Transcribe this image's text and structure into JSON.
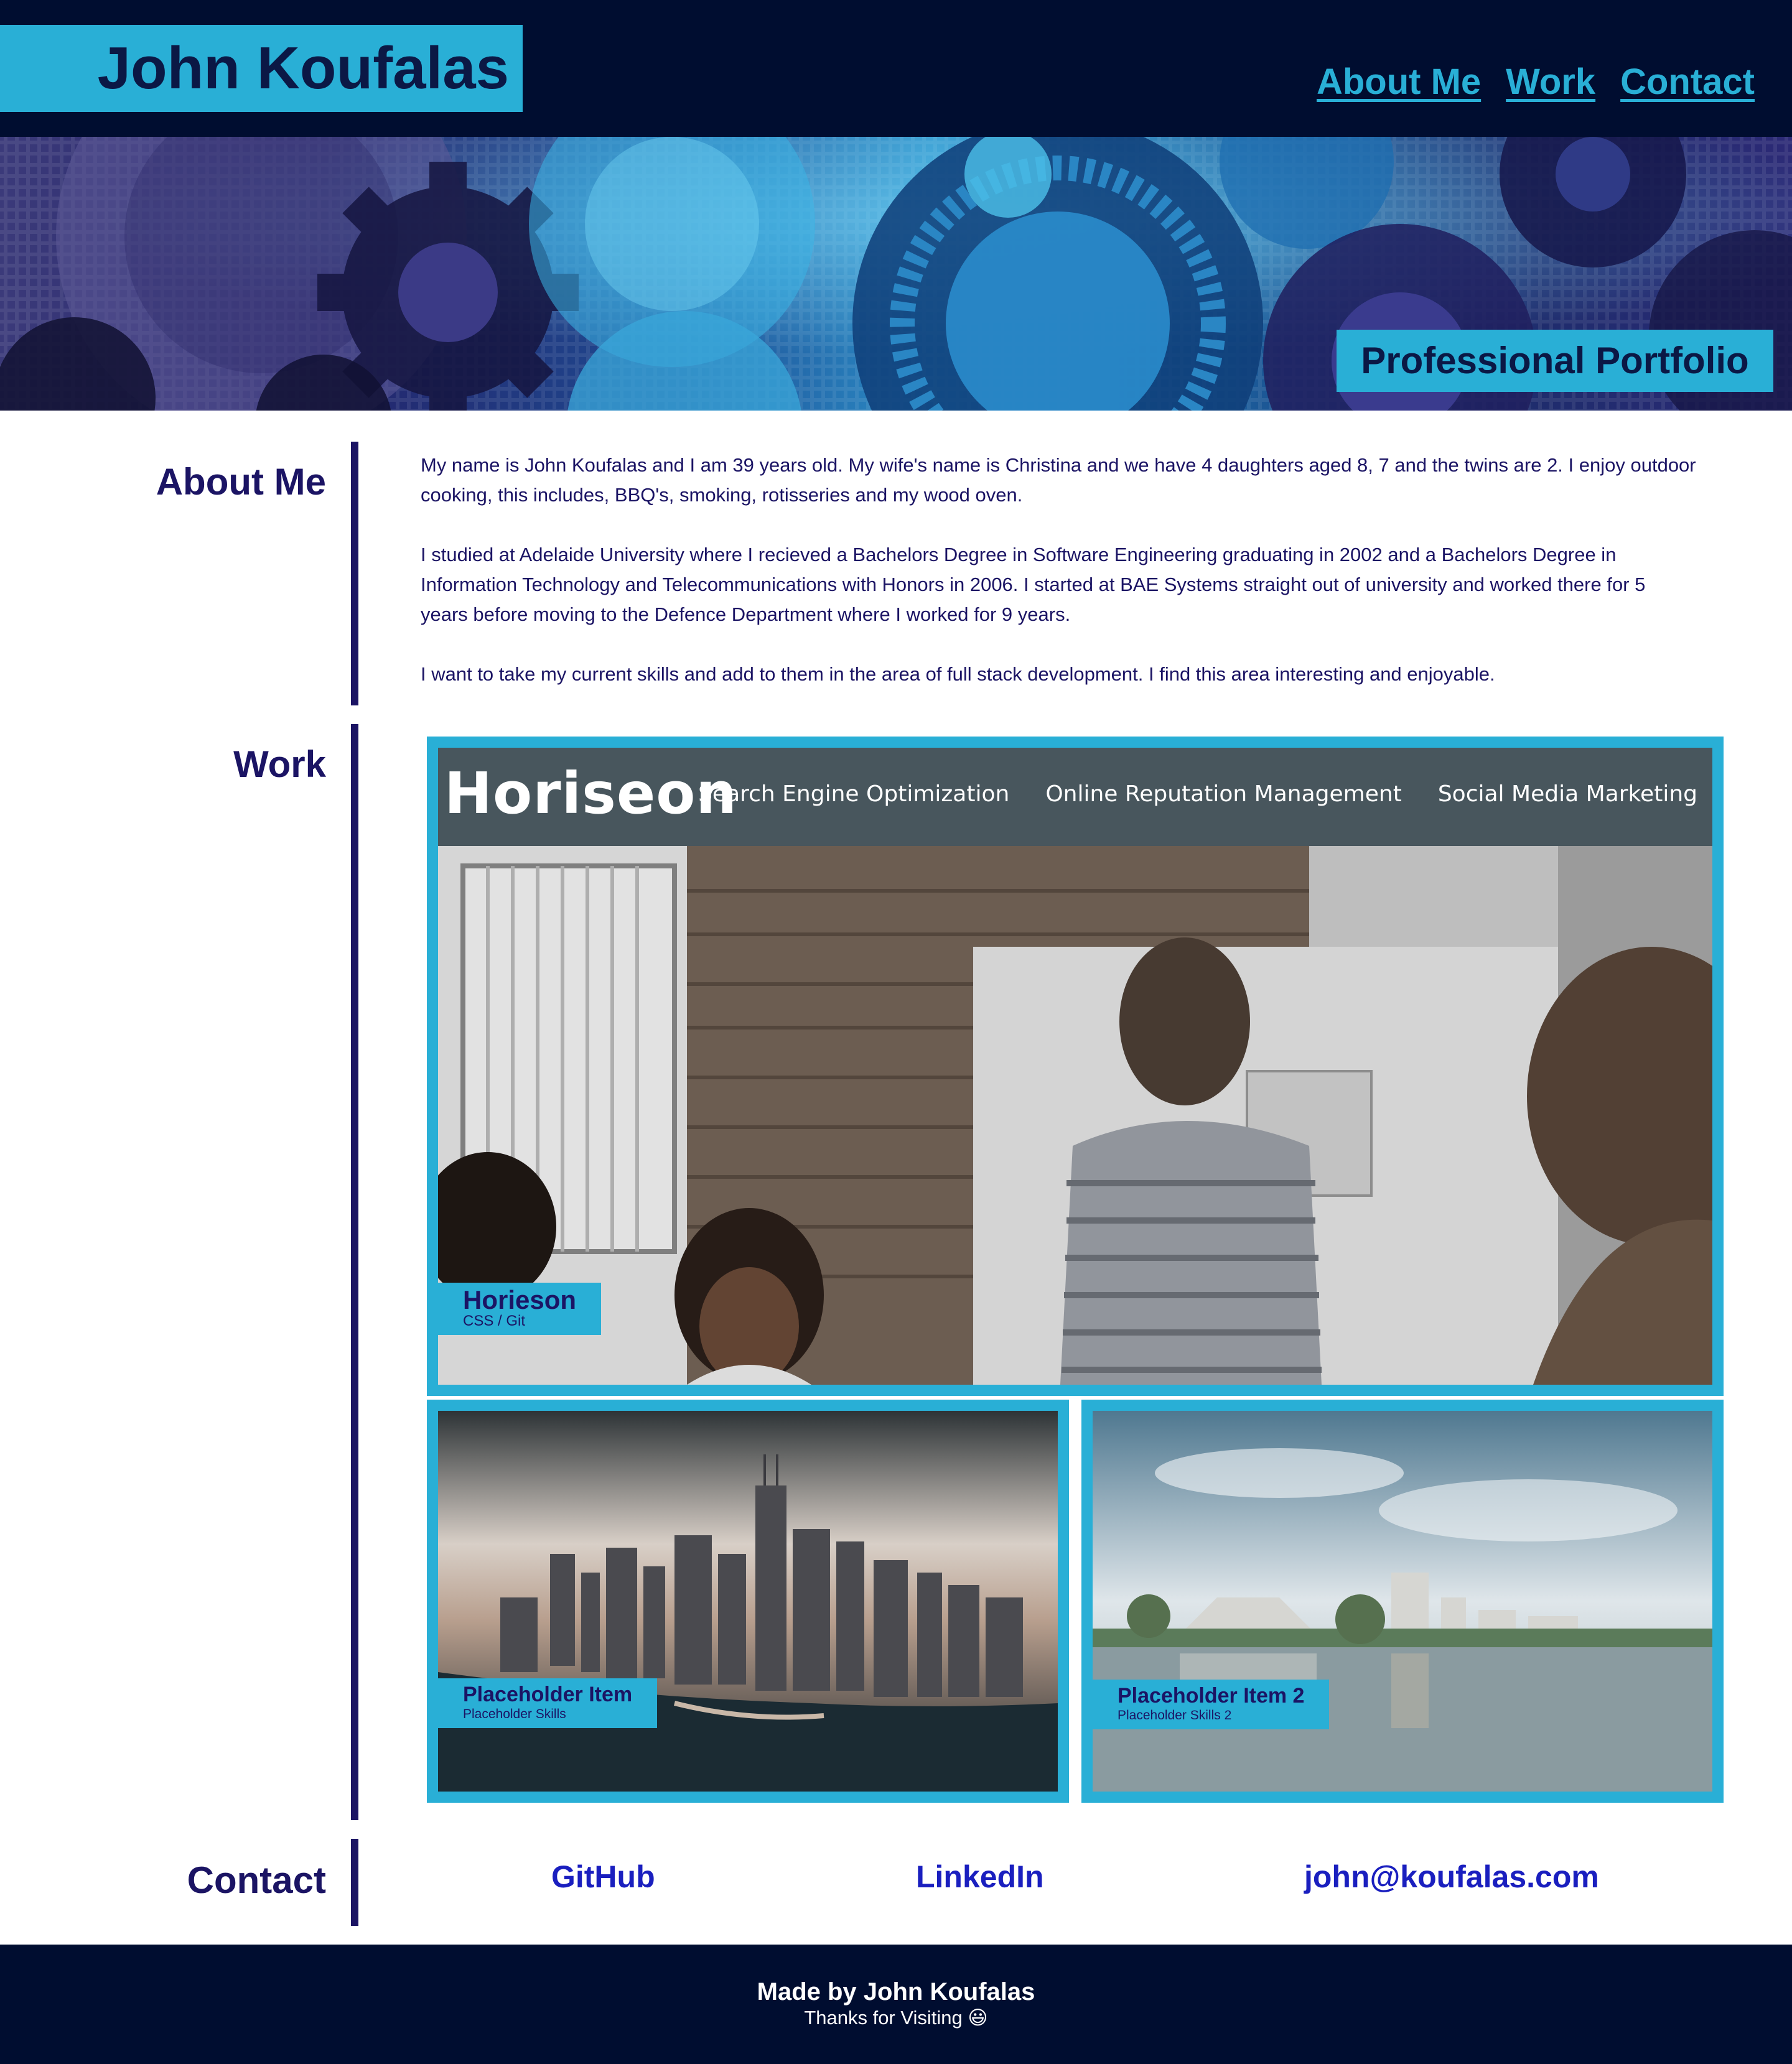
{
  "header": {
    "logo_text": "John Koufalas",
    "nav": [
      {
        "label": "About Me"
      },
      {
        "label": "Work"
      },
      {
        "label": "Contact"
      }
    ]
  },
  "hero": {
    "badge": "Professional Portfolio"
  },
  "about": {
    "title": "About Me",
    "paragraphs": [
      "My name is John Koufalas and I am 39 years old. My wife's name is Christina and we have 4 daughters aged 8, 7 and the twins are 2. I enjoy outdoor cooking, this includes, BBQ's, smoking, rotisseries and my wood oven.",
      "I studied at Adelaide University where I recieved a Bachelors Degree in Software Engineering graduating in 2002 and a Bachelors Degree in Information Technology and Telecommunications with Honors in 2006. I started at BAE Systems straight out of university and worked there for 5 years before moving to the Defence Department where I worked for 9 years.",
      "I want to take my current skills and add to them in the area of full stack development. I find this area interesting and enjoyable."
    ]
  },
  "work": {
    "title": "Work",
    "featured": {
      "title": "Horieson",
      "skills": "CSS / Git",
      "screenshot": {
        "brand": "Horiseon",
        "nav": [
          "Search Engine Optimization",
          "Online Reputation Management",
          "Social Media Marketing"
        ]
      }
    },
    "items": [
      {
        "title": "Placeholder Item",
        "skills": "Placeholder Skills"
      },
      {
        "title": "Placeholder Item 2",
        "skills": "Placeholder Skills 2"
      }
    ]
  },
  "contact": {
    "title": "Contact",
    "links": [
      {
        "label": "GitHub"
      },
      {
        "label": "LinkedIn"
      },
      {
        "label": "john@koufalas.com"
      }
    ]
  },
  "footer": {
    "made_by": "Made by John Koufalas",
    "thanks": "Thanks for Visiting 😃"
  },
  "colors": {
    "navy": "#000d30",
    "accent": "#29afd6",
    "text": "#1b1464",
    "link": "#1a1fbf"
  }
}
